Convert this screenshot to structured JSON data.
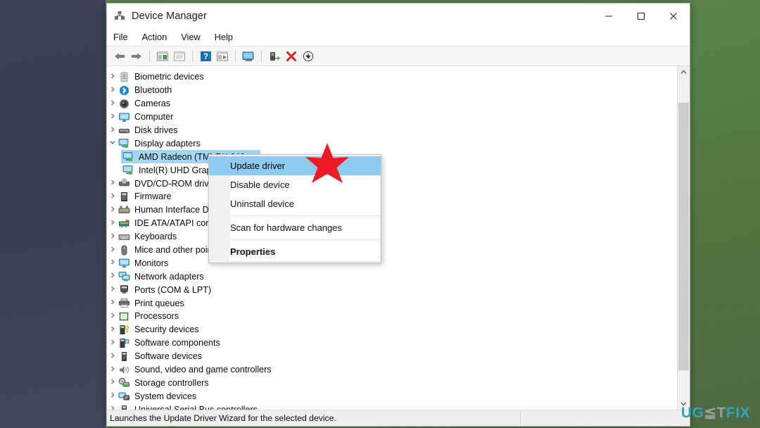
{
  "window": {
    "title": "Device Manager",
    "icon": "device-manager-icon",
    "buttons": {
      "minimize": "—",
      "maximize": "□",
      "close": "✕"
    }
  },
  "menubar": {
    "items": [
      "File",
      "Action",
      "View",
      "Help"
    ]
  },
  "toolbar": {
    "items": [
      {
        "name": "back-icon",
        "glyph": "◀"
      },
      {
        "name": "forward-icon",
        "glyph": "▶"
      },
      {
        "name": "separator",
        "glyph": ""
      },
      {
        "name": "show-hide-console-tree-icon",
        "glyph": ""
      },
      {
        "name": "properties-icon",
        "glyph": ""
      },
      {
        "name": "separator",
        "glyph": ""
      },
      {
        "name": "help-icon",
        "glyph": "?"
      },
      {
        "name": "update-driver-icon",
        "glyph": ""
      },
      {
        "name": "separator",
        "glyph": ""
      },
      {
        "name": "scan-for-hardware-changes-icon",
        "glyph": ""
      },
      {
        "name": "separator",
        "glyph": ""
      },
      {
        "name": "enable-device-icon",
        "glyph": ""
      },
      {
        "name": "uninstall-device-icon",
        "glyph": "✕"
      },
      {
        "name": "disable-device-icon",
        "glyph": "↓"
      }
    ]
  },
  "tree": {
    "nodes": [
      {
        "label": "Biometric devices",
        "level": 0,
        "expanded": false,
        "icon": "biometric-icon",
        "selected": false
      },
      {
        "label": "Bluetooth",
        "level": 0,
        "expanded": false,
        "icon": "bluetooth-icon",
        "selected": false
      },
      {
        "label": "Cameras",
        "level": 0,
        "expanded": false,
        "icon": "camera-icon",
        "selected": false
      },
      {
        "label": "Computer",
        "level": 0,
        "expanded": false,
        "icon": "computer-icon",
        "selected": false
      },
      {
        "label": "Disk drives",
        "level": 0,
        "expanded": false,
        "icon": "disk-drive-icon",
        "selected": false
      },
      {
        "label": "Display adapters",
        "level": 0,
        "expanded": true,
        "icon": "display-icon",
        "selected": false
      },
      {
        "label": "AMD Radeon (TM) RX 640",
        "level": 1,
        "expanded": null,
        "icon": "display-icon",
        "selected": true
      },
      {
        "label": "Intel(R) UHD Graphics",
        "level": 1,
        "expanded": null,
        "icon": "display-icon",
        "selected": false
      },
      {
        "label": "DVD/CD-ROM drives",
        "level": 0,
        "expanded": false,
        "icon": "dvd-icon",
        "selected": false
      },
      {
        "label": "Firmware",
        "level": 0,
        "expanded": false,
        "icon": "firmware-icon",
        "selected": false
      },
      {
        "label": "Human Interface Devices",
        "level": 0,
        "expanded": false,
        "icon": "hid-icon",
        "selected": false
      },
      {
        "label": "IDE ATA/ATAPI controllers",
        "level": 0,
        "expanded": false,
        "icon": "ide-icon",
        "selected": false
      },
      {
        "label": "Keyboards",
        "level": 0,
        "expanded": false,
        "icon": "keyboard-icon",
        "selected": false
      },
      {
        "label": "Mice and other pointing devices",
        "level": 0,
        "expanded": false,
        "icon": "mouse-icon",
        "selected": false
      },
      {
        "label": "Monitors",
        "level": 0,
        "expanded": false,
        "icon": "monitor-icon",
        "selected": false
      },
      {
        "label": "Network adapters",
        "level": 0,
        "expanded": false,
        "icon": "network-icon",
        "selected": false
      },
      {
        "label": "Ports (COM & LPT)",
        "level": 0,
        "expanded": false,
        "icon": "port-icon",
        "selected": false
      },
      {
        "label": "Print queues",
        "level": 0,
        "expanded": false,
        "icon": "printer-icon",
        "selected": false
      },
      {
        "label": "Processors",
        "level": 0,
        "expanded": false,
        "icon": "processor-icon",
        "selected": false
      },
      {
        "label": "Security devices",
        "level": 0,
        "expanded": false,
        "icon": "security-icon",
        "selected": false
      },
      {
        "label": "Software components",
        "level": 0,
        "expanded": false,
        "icon": "software-comp-icon",
        "selected": false
      },
      {
        "label": "Software devices",
        "level": 0,
        "expanded": false,
        "icon": "software-dev-icon",
        "selected": false
      },
      {
        "label": "Sound, video and game controllers",
        "level": 0,
        "expanded": false,
        "icon": "sound-icon",
        "selected": false
      },
      {
        "label": "Storage controllers",
        "level": 0,
        "expanded": false,
        "icon": "storage-icon",
        "selected": false
      },
      {
        "label": "System devices",
        "level": 0,
        "expanded": false,
        "icon": "system-icon",
        "selected": false
      },
      {
        "label": "Universal Serial Bus controllers",
        "level": 0,
        "expanded": false,
        "icon": "usb-icon",
        "selected": false
      }
    ],
    "chevron_collapsed": "›",
    "chevron_expanded": "⌄"
  },
  "context_menu": {
    "items": [
      {
        "label": "Update driver",
        "highlighted": true,
        "bold": false,
        "separator_after": false
      },
      {
        "label": "Disable device",
        "highlighted": false,
        "bold": false,
        "separator_after": false
      },
      {
        "label": "Uninstall device",
        "highlighted": false,
        "bold": false,
        "separator_after": true
      },
      {
        "label": "Scan for hardware changes",
        "highlighted": false,
        "bold": false,
        "separator_after": true
      },
      {
        "label": "Properties",
        "highlighted": false,
        "bold": true,
        "separator_after": false
      }
    ],
    "highlight_color": "#8fcbf0"
  },
  "statusbar": {
    "text": "Launches the Update Driver Wizard for the selected device."
  },
  "scrollbar": {
    "up_glyph": "▲",
    "down_glyph": "▼"
  },
  "watermark": {
    "part1": "UG",
    "part2": "≦T",
    "part3": "FIX",
    "color1": "#2ea3c4",
    "color2": "#9aa39a"
  },
  "annotation": {
    "star_color": "#ee1b24",
    "star_name": "red-star-pointer"
  }
}
